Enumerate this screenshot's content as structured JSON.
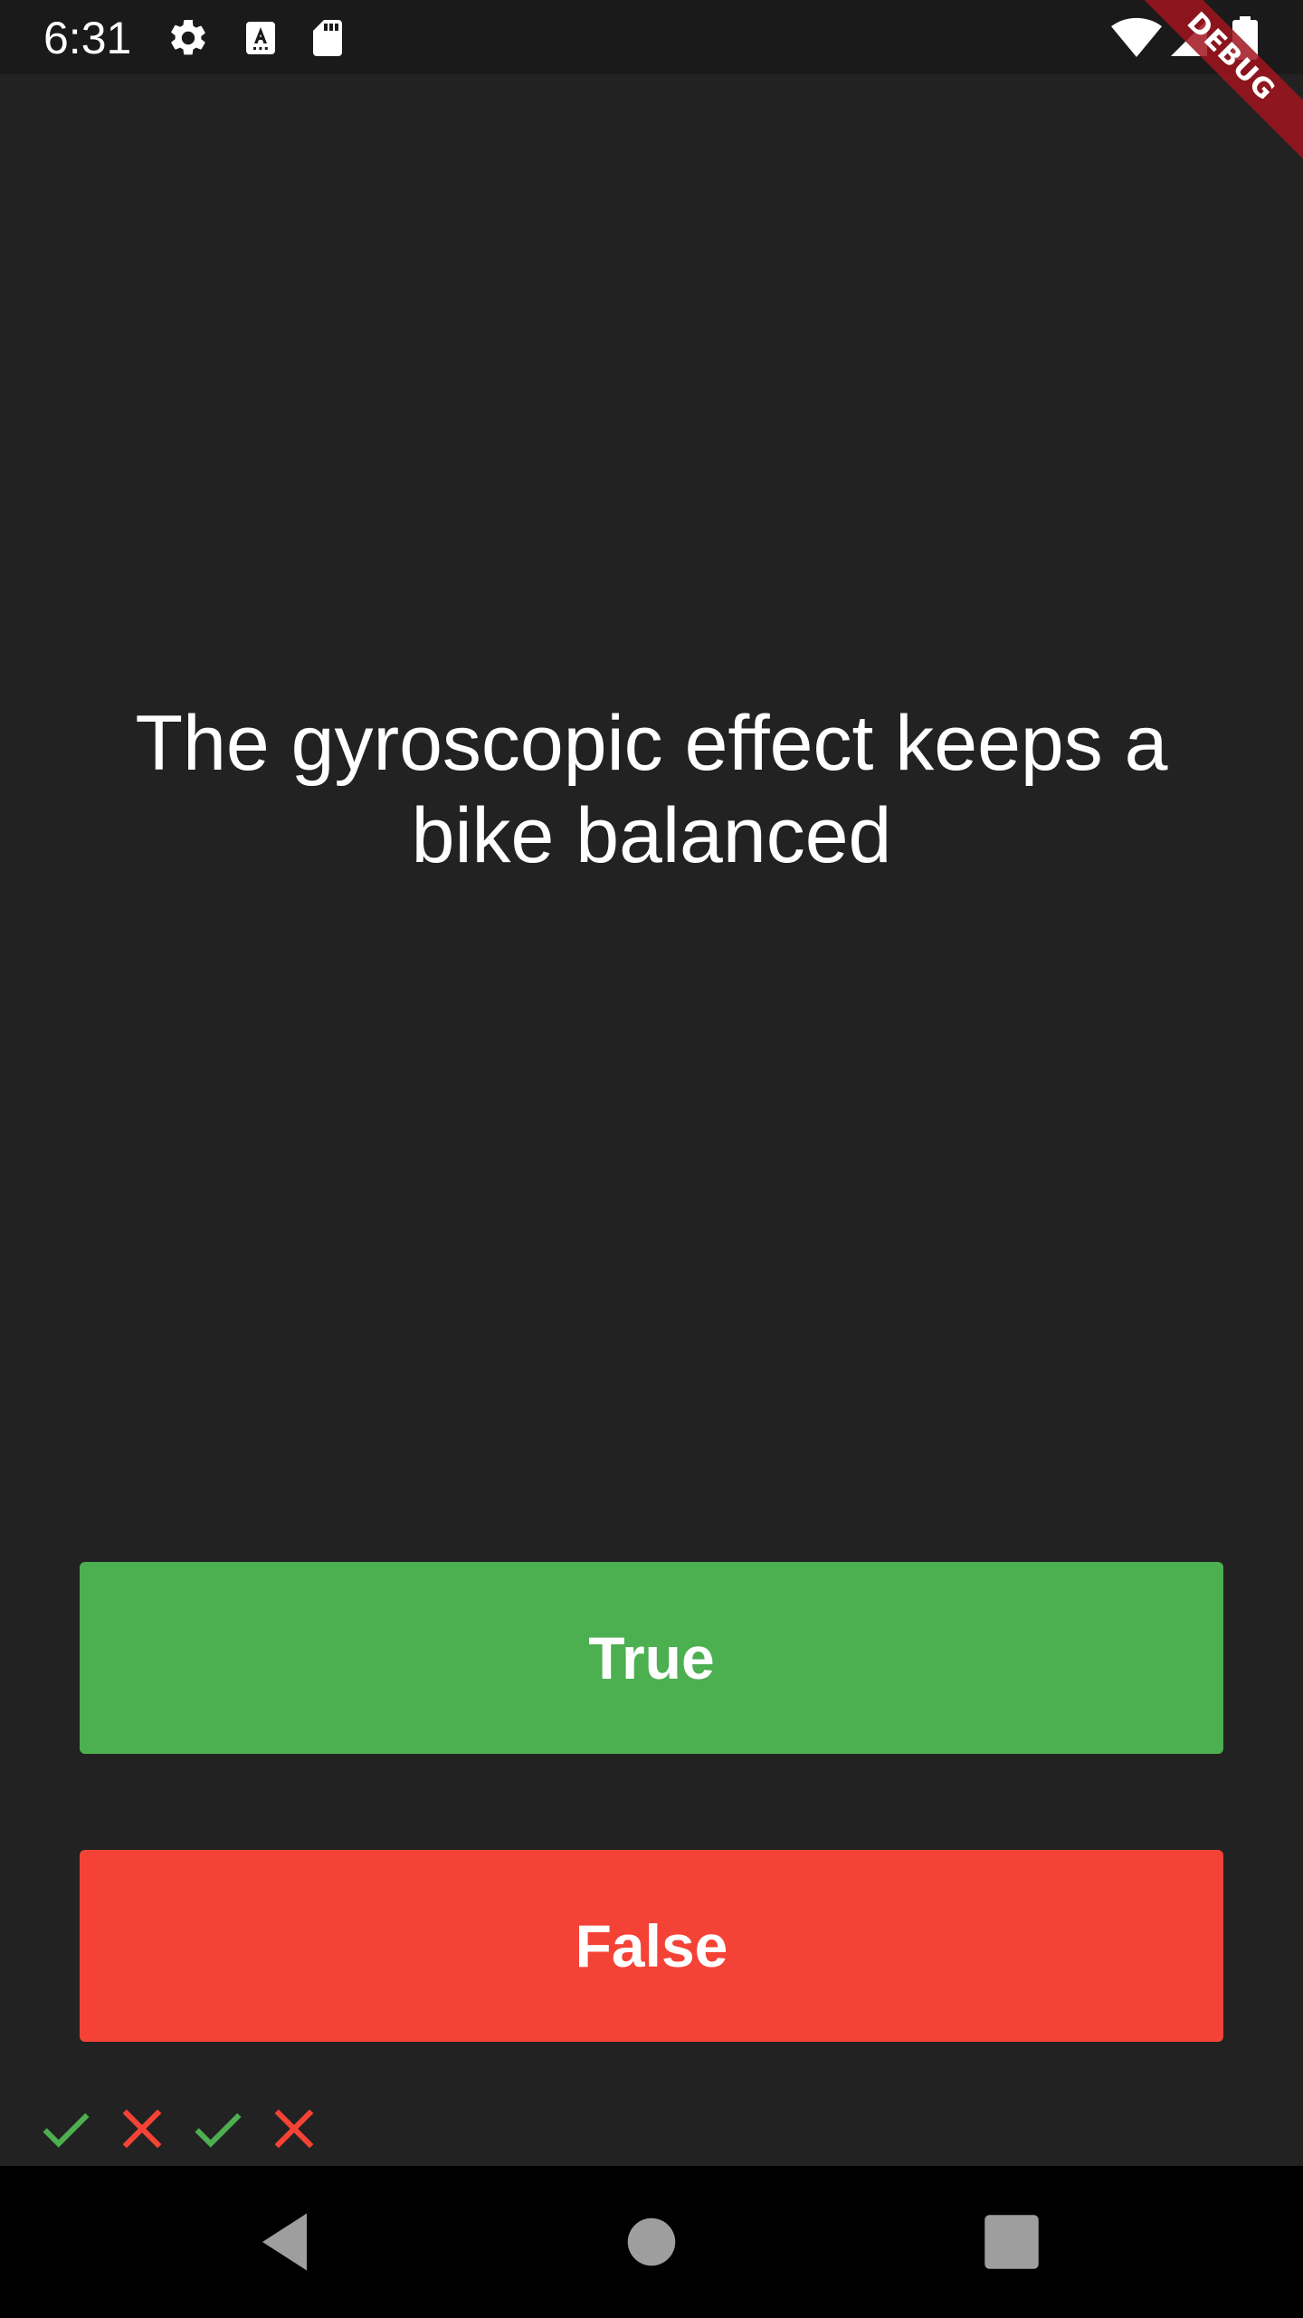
{
  "status_bar": {
    "time": "6:31",
    "icons": [
      "gear-icon",
      "text-a-icon",
      "sd-card-icon",
      "wifi-icon",
      "signal-icon",
      "battery-icon"
    ]
  },
  "debug_banner": {
    "label": "DEBUG"
  },
  "quiz": {
    "question": "The gyroscopic effect keeps a bike balanced",
    "true_label": "True",
    "false_label": "False"
  },
  "score_keeper": {
    "results": [
      "correct",
      "wrong",
      "correct",
      "wrong"
    ]
  },
  "colors": {
    "background": "#222222",
    "true_button": "#4caf50",
    "false_button": "#f44336",
    "check": "#4caf50",
    "cross": "#f44336"
  },
  "nav_bar": {
    "buttons": [
      "back-icon",
      "home-icon",
      "recents-icon"
    ]
  }
}
